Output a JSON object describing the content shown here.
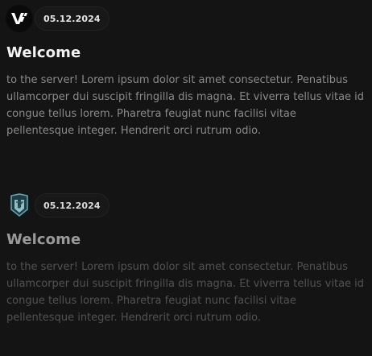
{
  "posts": [
    {
      "avatar_icon": "v-logo-icon",
      "date": "05.12.2024",
      "title": "Welcome",
      "body": "to the server! Lorem ipsum dolor sit amet consectetur. Penatibus ullamcorper dui suscipit fringilla dis magna. Et viverra tellus vitae id congue tellus lorem. Pharetra feugiat nunc facilisi vitae pellentesque integer. Hendrerit orci rutrum odio."
    },
    {
      "avatar_icon": "shield-logo-icon",
      "date": "05.12.2024",
      "title": "Welcome",
      "body": "to the server! Lorem ipsum dolor sit amet consectetur. Penatibus ullamcorper dui suscipit fringilla dis magna. Et viverra tellus vitae id congue tellus lorem. Pharetra feugiat nunc facilisi vitae pellentesque integer. Hendrerit orci rutrum odio."
    }
  ],
  "colors": {
    "background": "#141414",
    "title": "#f2f2f2",
    "body": "#8a8a8a",
    "badge_bg": "#181818",
    "logo_teal": "#5fa3b0"
  }
}
